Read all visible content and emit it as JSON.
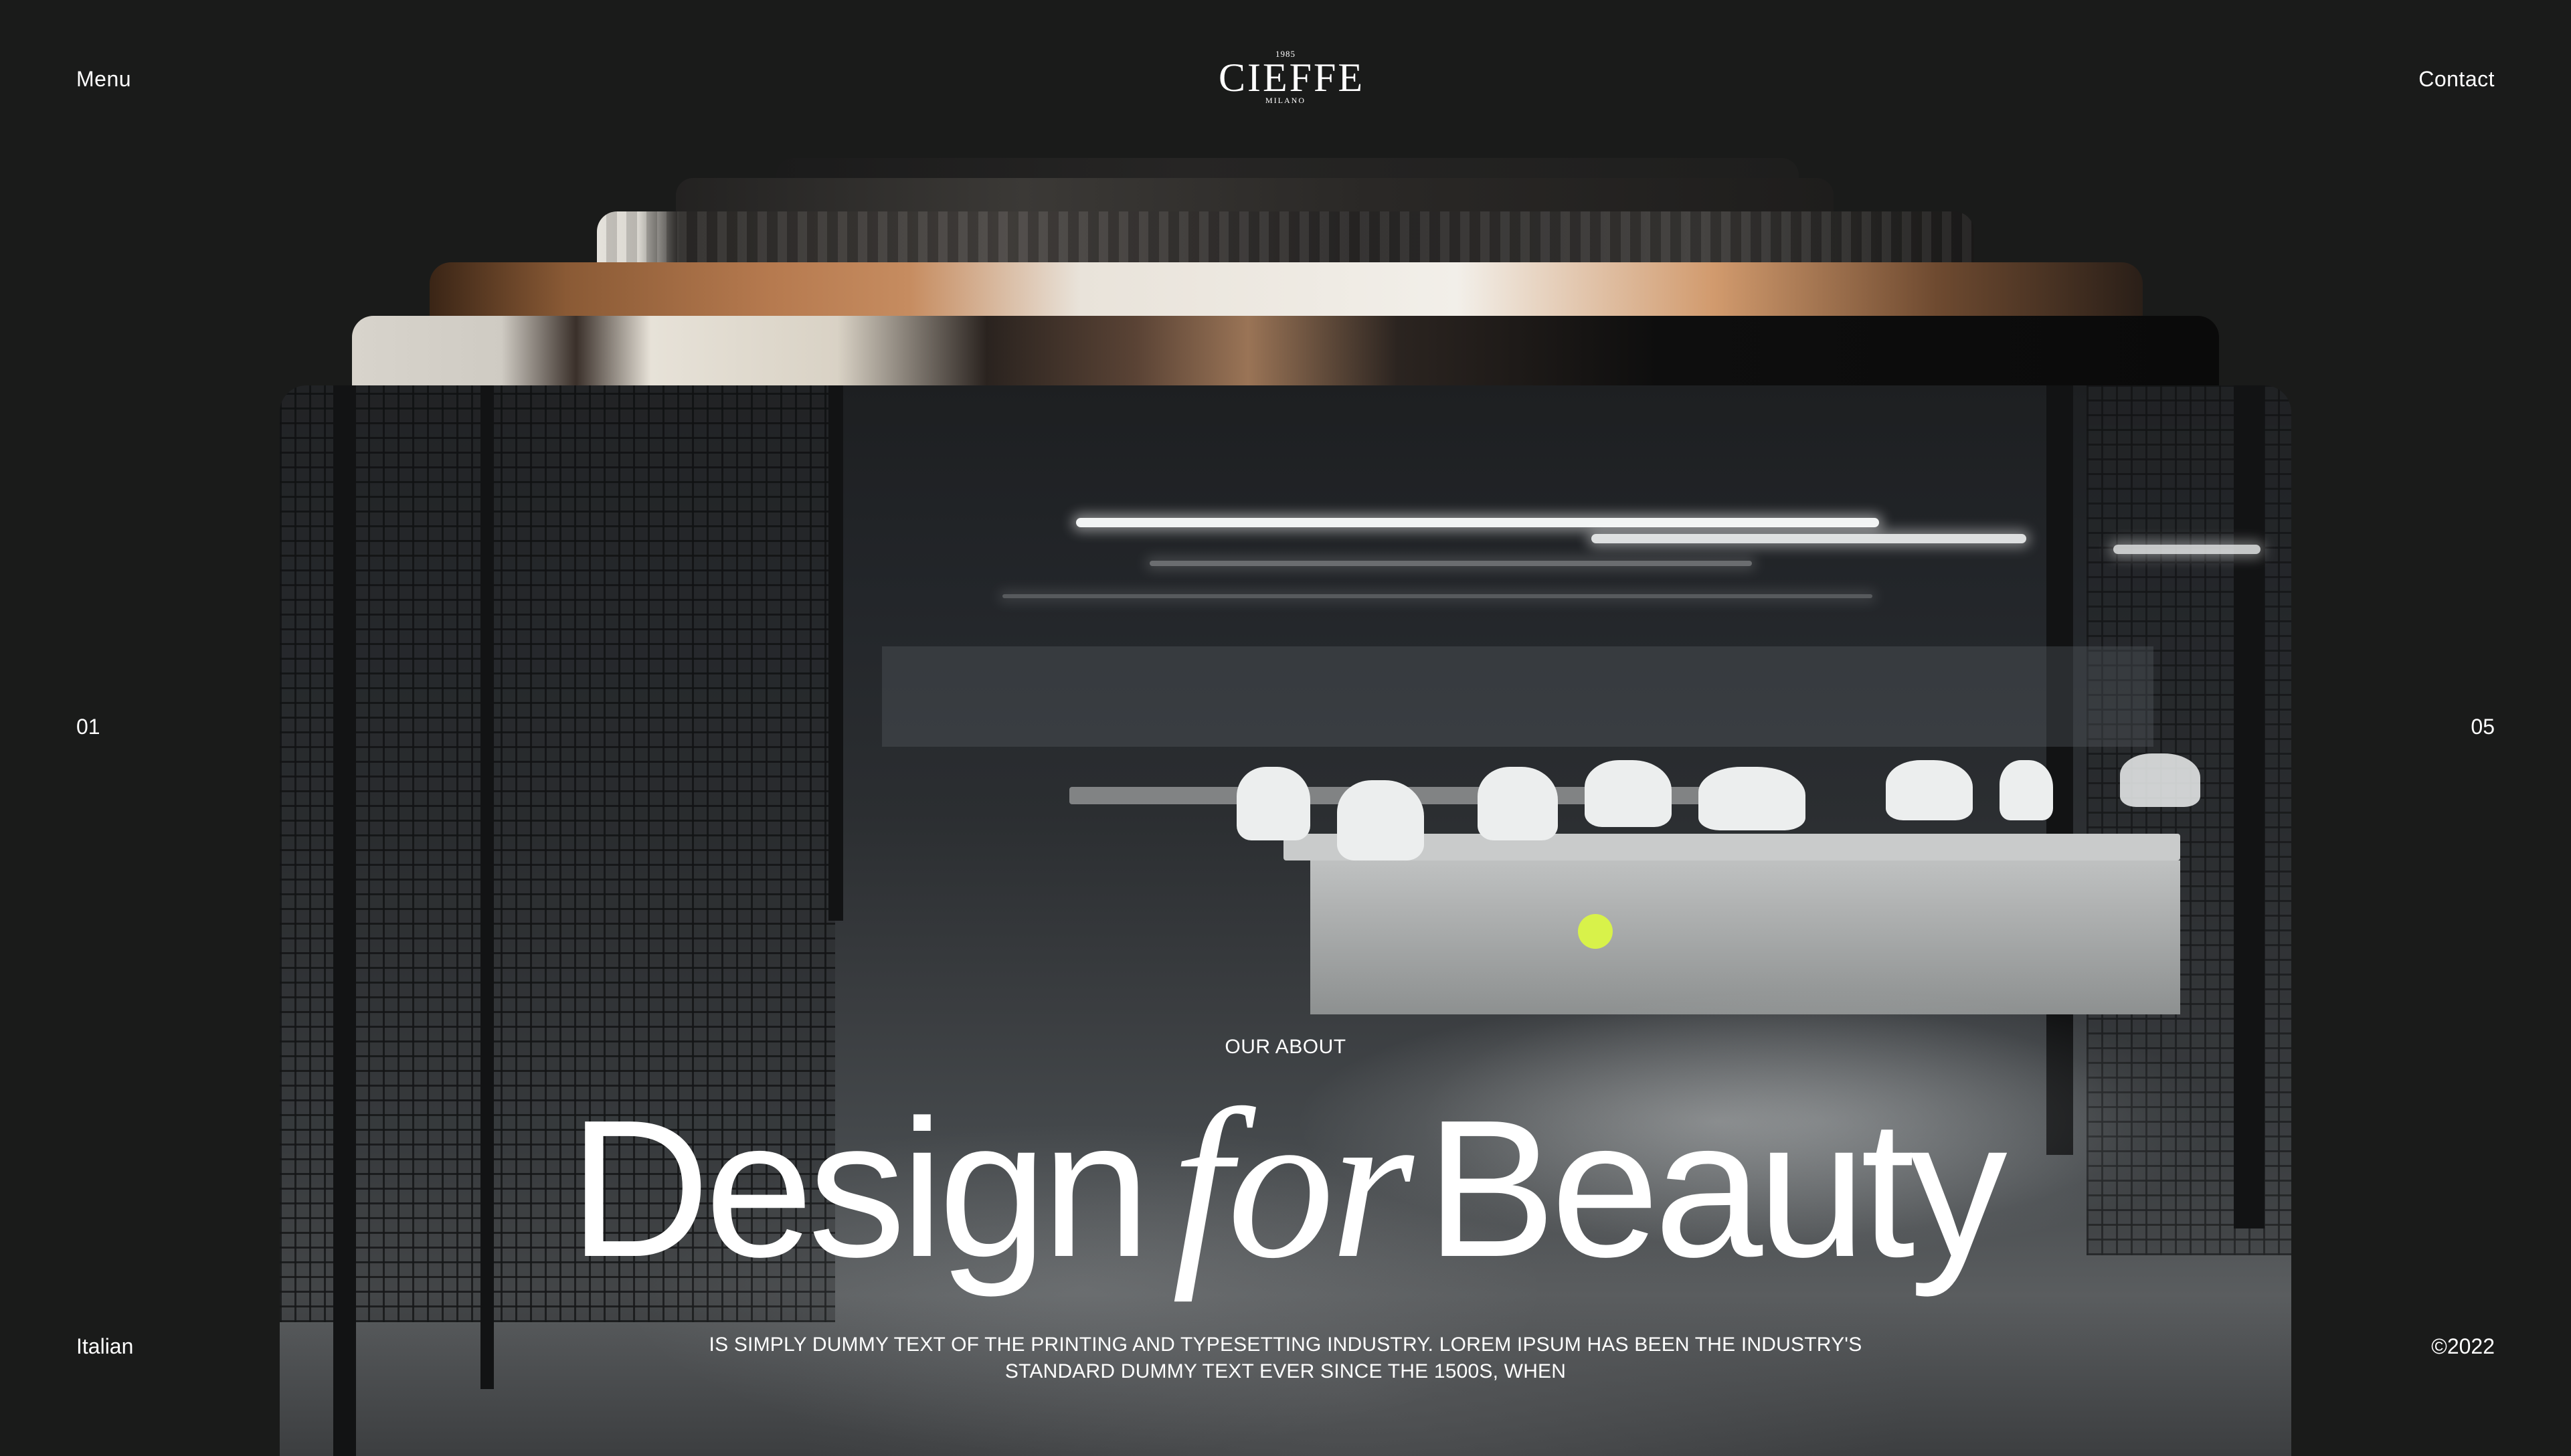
{
  "header": {
    "menu_label": "Menu",
    "contact_label": "Contact",
    "logo": {
      "year": "1985",
      "name": "CIEFFE",
      "city": "MILANO"
    }
  },
  "slider": {
    "current": "01",
    "total": "05"
  },
  "footer": {
    "language": "Italian",
    "copyright": "©2022"
  },
  "hero": {
    "eyebrow": "OUR ABOUT",
    "headline": {
      "word1": "Design",
      "word2": "for",
      "word3": "Beauty"
    },
    "subtext": "IS SIMPLY DUMMY TEXT OF THE PRINTING AND TYPESETTING INDUSTRY. LOREM IPSUM HAS BEEN THE INDUSTRY'S STANDARD DUMMY TEXT EVER SINCE THE 1500S, WHEN"
  },
  "colors": {
    "background": "#1a1b1a",
    "text": "#ffffff",
    "accent": "#d8f24a"
  }
}
